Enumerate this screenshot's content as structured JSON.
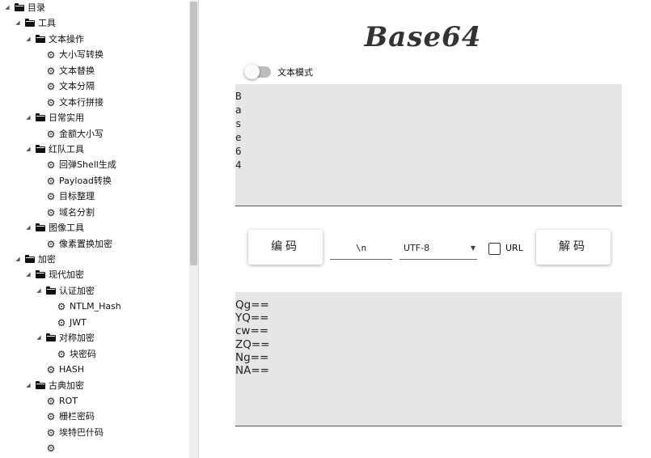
{
  "tree": {
    "items": [
      {
        "label": "目录",
        "type": "folder",
        "level": 0
      },
      {
        "label": "工具",
        "type": "folder",
        "level": 1
      },
      {
        "label": "文本操作",
        "type": "folder",
        "level": 2
      },
      {
        "label": "大小写转换",
        "type": "tool",
        "level": 3
      },
      {
        "label": "文本替换",
        "type": "tool",
        "level": 3
      },
      {
        "label": "文本分隔",
        "type": "tool",
        "level": 3
      },
      {
        "label": "文本行拼接",
        "type": "tool",
        "level": 3
      },
      {
        "label": "日常实用",
        "type": "folder",
        "level": 2
      },
      {
        "label": "金额大小写",
        "type": "tool",
        "level": 3
      },
      {
        "label": "红队工具",
        "type": "folder",
        "level": 2
      },
      {
        "label": "回弹Shell生成",
        "type": "tool",
        "level": 3
      },
      {
        "label": "Payload转换",
        "type": "tool",
        "level": 3
      },
      {
        "label": "目标整理",
        "type": "tool",
        "level": 3
      },
      {
        "label": "域名分割",
        "type": "tool",
        "level": 3
      },
      {
        "label": "图像工具",
        "type": "folder",
        "level": 2
      },
      {
        "label": "像素置换加密",
        "type": "tool",
        "level": 3
      },
      {
        "label": "加密",
        "type": "folder",
        "level": 1
      },
      {
        "label": "现代加密",
        "type": "folder",
        "level": 2
      },
      {
        "label": "认证加密",
        "type": "folder",
        "level": 3
      },
      {
        "label": "NTLM_Hash",
        "type": "tool",
        "level": 4
      },
      {
        "label": "JWT",
        "type": "tool",
        "level": 4
      },
      {
        "label": "对称加密",
        "type": "folder",
        "level": 3
      },
      {
        "label": "块密码",
        "type": "tool",
        "level": 4
      },
      {
        "label": "HASH",
        "type": "tool",
        "level": 3
      },
      {
        "label": "古典加密",
        "type": "folder",
        "level": 2
      },
      {
        "label": "ROT",
        "type": "tool",
        "level": 3
      },
      {
        "label": "栅栏密码",
        "type": "tool",
        "level": 3
      },
      {
        "label": "埃特巴什码",
        "type": "tool",
        "level": 3
      },
      {
        "label": "",
        "type": "tool",
        "level": 3
      }
    ]
  },
  "main": {
    "title": "Base64",
    "text_mode": {
      "label": "文本模式",
      "checked": false
    },
    "input_text": "B\na\ns\ne\n6\n4",
    "encode_label": "编码",
    "separator_value": "\\n",
    "charset": {
      "selected": "UTF-8"
    },
    "url": {
      "label": "URL",
      "checked": false
    },
    "decode_label": "解码",
    "output_text": "Qg==\nYQ==\ncw==\nZQ==\nNg==\nNA=="
  },
  "colors": {
    "panel_background": "#e6e6e6",
    "underline": "#555555",
    "toggle_track": "#bdbdbd"
  }
}
